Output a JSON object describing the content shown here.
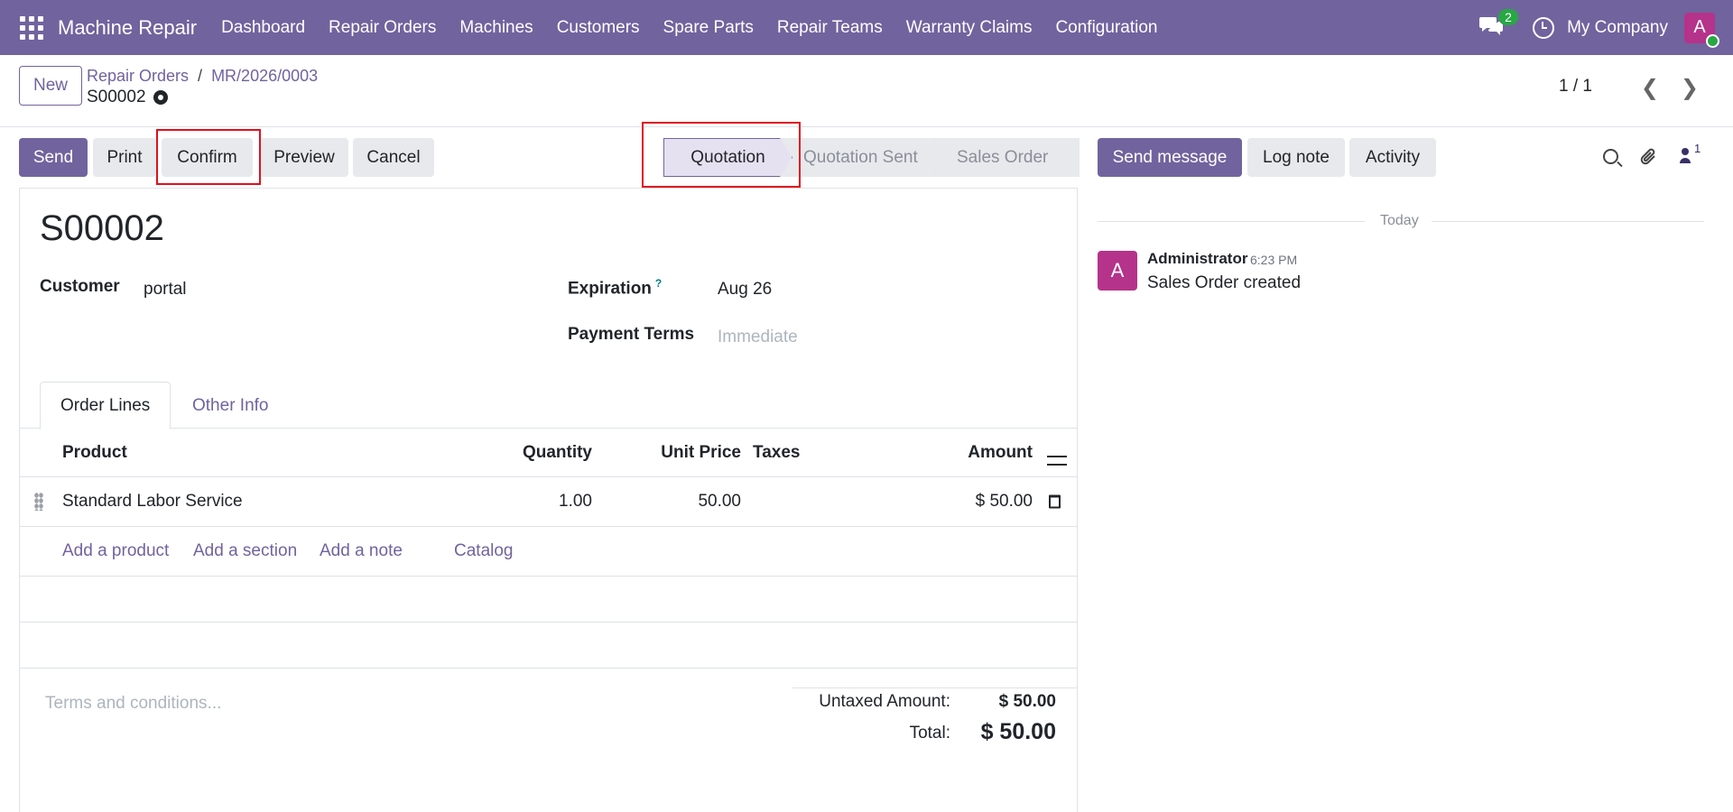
{
  "navbar": {
    "app_title": "Machine Repair",
    "menu": [
      "Dashboard",
      "Repair Orders",
      "Machines",
      "Customers",
      "Spare Parts",
      "Repair Teams",
      "Warranty Claims",
      "Configuration"
    ],
    "chat_count": "2",
    "company": "My Company",
    "avatar_letter": "A"
  },
  "control": {
    "new_label": "New",
    "breadcrumb": [
      "Repair Orders",
      "MR/2026/0003"
    ],
    "record_name": "S00002",
    "pager": "1 / 1"
  },
  "actions": {
    "send": "Send",
    "print": "Print",
    "confirm": "Confirm",
    "preview": "Preview",
    "cancel": "Cancel"
  },
  "stages": [
    "Quotation",
    "Quotation Sent",
    "Sales Order"
  ],
  "form": {
    "title": "S00002",
    "customer_label": "Customer",
    "customer_value": "portal",
    "expiration_label": "Expiration",
    "expiration_help": "?",
    "expiration_value": "Aug 26",
    "payment_terms_label": "Payment Terms",
    "payment_terms_placeholder": "Immediate",
    "tabs": [
      "Order Lines",
      "Other Info"
    ],
    "columns": {
      "product": "Product",
      "quantity": "Quantity",
      "unit_price": "Unit Price",
      "taxes": "Taxes",
      "amount": "Amount"
    },
    "lines": [
      {
        "product": "Standard Labor Service",
        "quantity": "1.00",
        "unit_price": "50.00",
        "taxes": "",
        "amount": "$ 50.00"
      }
    ],
    "add_links": [
      "Add a product",
      "Add a section",
      "Add a note",
      "Catalog"
    ],
    "terms_placeholder": "Terms and conditions...",
    "untaxed_label": "Untaxed Amount:",
    "untaxed_value": "$ 50.00",
    "total_label": "Total:",
    "total_value": "$ 50.00"
  },
  "chatter": {
    "send_message": "Send message",
    "log_note": "Log note",
    "activity": "Activity",
    "followers_count": "1",
    "date_separator": "Today",
    "messages": [
      {
        "avatar_letter": "A",
        "author": "Administrator",
        "time": "6:23 PM",
        "body": "Sales Order created"
      }
    ]
  },
  "colors": {
    "brand": "#71639e",
    "avatar": "#b5338a",
    "online": "#28a745",
    "highlight": "#e0101e"
  }
}
